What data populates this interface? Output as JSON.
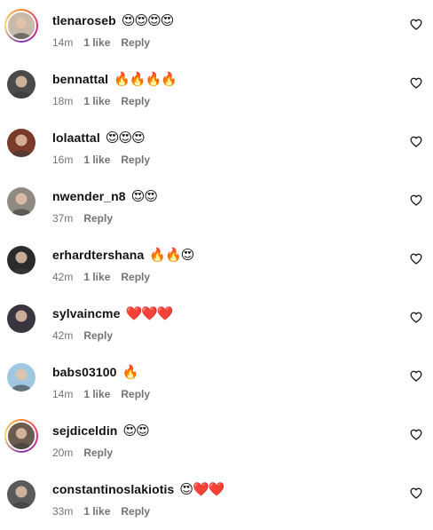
{
  "comments": [
    {
      "username": "tlenaroseb",
      "emojis": "😍😍😍😍",
      "emoji_kind": "heart-eyes",
      "time": "14m",
      "likes": "1 like",
      "reply": "Reply",
      "story_ring": true,
      "avatar_color": "#c8b9aa"
    },
    {
      "username": "bennattal",
      "emojis": "🔥🔥🔥🔥",
      "emoji_kind": "fire",
      "time": "18m",
      "likes": "1 like",
      "reply": "Reply",
      "story_ring": false,
      "avatar_color": "#4a4a4a"
    },
    {
      "username": "lolaattal",
      "emojis": "😍😍😍",
      "emoji_kind": "heart-eyes",
      "time": "16m",
      "likes": "1 like",
      "reply": "Reply",
      "story_ring": false,
      "avatar_color": "#7a3b2a"
    },
    {
      "username": "nwender_n8",
      "emojis": "😍😍",
      "emoji_kind": "heart-eyes",
      "time": "37m",
      "likes": "",
      "reply": "Reply",
      "story_ring": false,
      "avatar_color": "#8e8a82"
    },
    {
      "username": "erhardtershana",
      "emojis": "🔥🔥😍",
      "emoji_kind": "mixed-fire",
      "time": "42m",
      "likes": "1 like",
      "reply": "Reply",
      "story_ring": false,
      "avatar_color": "#2b2b2b"
    },
    {
      "username": "sylvaincme",
      "emojis": "❤️❤️❤️",
      "emoji_kind": "heart",
      "time": "42m",
      "likes": "",
      "reply": "Reply",
      "story_ring": false,
      "avatar_color": "#3a3340"
    },
    {
      "username": "babs03100",
      "emojis": "🔥",
      "emoji_kind": "fire",
      "time": "14m",
      "likes": "1 like",
      "reply": "Reply",
      "story_ring": false,
      "avatar_color": "#9fc7e0"
    },
    {
      "username": "sejdiceldin",
      "emojis": "😍😍",
      "emoji_kind": "heart-eyes",
      "time": "20m",
      "likes": "",
      "reply": "Reply",
      "story_ring": true,
      "avatar_color": "#6b5b50"
    },
    {
      "username": "constantinoslakiotis",
      "emojis": "😍❤️❤️",
      "emoji_kind": "mixed-heart",
      "time": "33m",
      "likes": "1 like",
      "reply": "Reply",
      "story_ring": false,
      "avatar_color": "#5a5a5a"
    }
  ],
  "icons": {
    "like": "heart-outline-icon"
  },
  "colors": {
    "text": "#111111",
    "meta": "#737373",
    "background": "#ffffff"
  }
}
